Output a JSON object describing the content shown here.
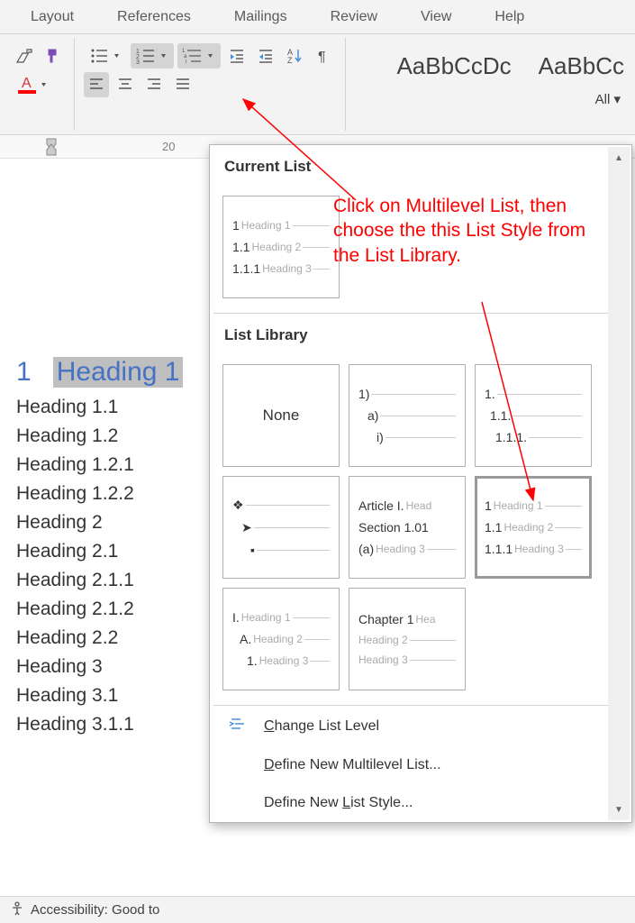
{
  "ribbon": {
    "tabs": [
      "Layout",
      "References",
      "Mailings",
      "Review",
      "View",
      "Help"
    ],
    "styles_preview": [
      "AaBbCcDc",
      "AaBbCc"
    ],
    "all_label": "All ▾"
  },
  "ruler": {
    "number": "20"
  },
  "document": {
    "heading_num": "1",
    "heading_text": "Heading 1",
    "lines": [
      "Heading 1.1",
      "Heading 1.2",
      "Heading 1.2.1",
      "Heading 1.2.2",
      "Heading 2",
      "Heading 2.1",
      "Heading 2.1.1",
      "Heading 2.1.2",
      "Heading 2.2",
      "Heading 3",
      "Heading 3.1",
      "Heading 3.1.1"
    ]
  },
  "dropdown": {
    "current_title": "Current List",
    "current_lines": [
      {
        "num": "1",
        "lbl": "Heading 1"
      },
      {
        "num": "1.1",
        "lbl": "Heading 2"
      },
      {
        "num": "1.1.1",
        "lbl": "Heading 3"
      }
    ],
    "library_title": "List Library",
    "none_label": "None",
    "thumbs": {
      "t2": [
        {
          "num": "1)",
          "lbl": ""
        },
        {
          "num": "a)",
          "lbl": ""
        },
        {
          "num": "i)",
          "lbl": ""
        }
      ],
      "t3": [
        {
          "num": "1.",
          "lbl": ""
        },
        {
          "num": "1.1.",
          "lbl": ""
        },
        {
          "num": "1.1.1.",
          "lbl": ""
        }
      ],
      "t5": [
        {
          "num": "Article I.",
          "lbl": "Head"
        },
        {
          "num": "Section 1.01",
          "lbl": ""
        },
        {
          "num": "(a)",
          "lbl": "Heading 3"
        }
      ],
      "t6": [
        {
          "num": "1",
          "lbl": "Heading 1"
        },
        {
          "num": "1.1",
          "lbl": "Heading 2"
        },
        {
          "num": "1.1.1",
          "lbl": "Heading 3"
        }
      ],
      "t7": [
        {
          "num": "I.",
          "lbl": "Heading 1"
        },
        {
          "num": "A.",
          "lbl": "Heading 2"
        },
        {
          "num": "1.",
          "lbl": "Heading 3"
        }
      ],
      "t8": [
        {
          "num": "Chapter 1",
          "lbl": "Hea"
        },
        {
          "num": "Heading 2",
          "lbl": ""
        },
        {
          "num": "Heading 3",
          "lbl": ""
        }
      ]
    },
    "menu": {
      "change_level": "Change List Level",
      "define_multilevel": "Define New Multilevel List...",
      "define_style": "Define New List Style..."
    }
  },
  "annotation": {
    "text": "Click on Multilevel List, then choose the this List Style from the List Library."
  },
  "statusbar": {
    "accessibility": "Accessibility: Good to"
  }
}
